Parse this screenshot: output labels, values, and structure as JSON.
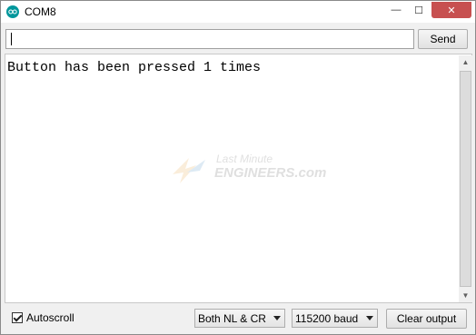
{
  "window": {
    "title": "COM8",
    "controls": {
      "minimize": "—",
      "maximize": "☐",
      "close": "✕"
    }
  },
  "input": {
    "value": "",
    "placeholder": ""
  },
  "send_button": {
    "label": "Send"
  },
  "output": {
    "lines": [
      "Button has been pressed 1 times"
    ]
  },
  "watermark": {
    "line1": "Last Minute",
    "line2": "ENGINEERS.com"
  },
  "bottom": {
    "autoscroll_label": "Autoscroll",
    "autoscroll_checked": true,
    "line_ending": "Both NL & CR",
    "baud_rate": "115200 baud",
    "clear_label": "Clear output"
  },
  "colors": {
    "close_button": "#c75050",
    "app_icon": "#00979c"
  }
}
